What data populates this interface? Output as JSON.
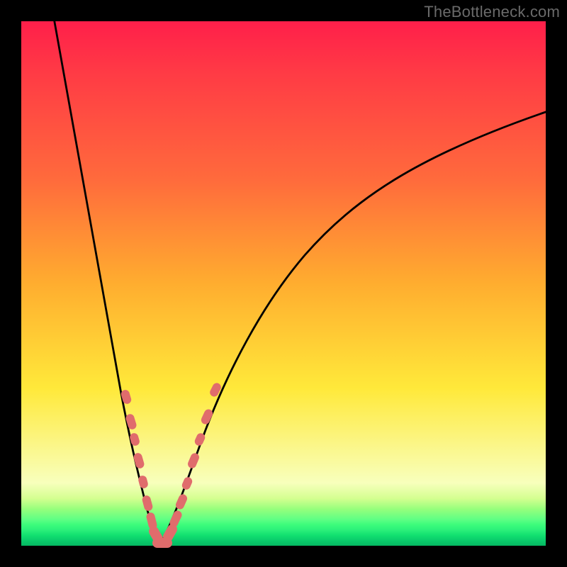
{
  "watermark": "TheBottleneck.com",
  "colors": {
    "frame": "#000000",
    "curve": "#000000",
    "salmon": "#e06c6c",
    "gradient_top": "#ff1f4a",
    "gradient_bottom": "#05b862"
  },
  "chart_data": {
    "type": "line",
    "title": "",
    "xlabel": "",
    "ylabel": "",
    "xlim": [
      0,
      100
    ],
    "ylim": [
      0,
      100
    ],
    "note": "Two monotone curves forming a V. Left branch descends steeply from top-left to a minimum near x≈25. Right branch rises from the same minimum toward upper-right, leveling off. Salmon pill-shaped markers cluster along both branches in the lower ~30% of the plot. Values estimated from pixel geometry; no axes or ticks shown.",
    "series": [
      {
        "name": "left_branch",
        "x": [
          5,
          8,
          10,
          12,
          14,
          16,
          18,
          19,
          20,
          21,
          22,
          23,
          24,
          25
        ],
        "y": [
          100,
          92,
          85,
          76,
          66,
          55,
          42,
          35,
          28,
          22,
          15,
          9,
          4,
          0
        ]
      },
      {
        "name": "right_branch",
        "x": [
          25,
          26,
          27,
          28,
          29,
          30,
          32,
          35,
          40,
          45,
          50,
          60,
          70,
          80,
          90,
          100
        ],
        "y": [
          0,
          3,
          7,
          12,
          17,
          22,
          30,
          38,
          48,
          55,
          60,
          68,
          74,
          78,
          81,
          83
        ]
      }
    ],
    "markers": [
      {
        "branch": "left",
        "x": 17.5,
        "y": 30
      },
      {
        "branch": "left",
        "x": 18.6,
        "y": 25
      },
      {
        "branch": "left",
        "x": 19.3,
        "y": 22
      },
      {
        "branch": "left",
        "x": 20.0,
        "y": 18
      },
      {
        "branch": "left",
        "x": 20.8,
        "y": 15
      },
      {
        "branch": "left",
        "x": 21.5,
        "y": 12
      },
      {
        "branch": "left",
        "x": 22.3,
        "y": 8
      },
      {
        "branch": "left",
        "x": 23.0,
        "y": 5
      },
      {
        "branch": "left",
        "x": 24.0,
        "y": 2
      },
      {
        "branch": "left",
        "x": 25.0,
        "y": 0.5
      },
      {
        "branch": "right",
        "x": 26.0,
        "y": 1
      },
      {
        "branch": "right",
        "x": 27.0,
        "y": 3
      },
      {
        "branch": "right",
        "x": 27.8,
        "y": 5
      },
      {
        "branch": "right",
        "x": 28.5,
        "y": 9
      },
      {
        "branch": "right",
        "x": 29.3,
        "y": 13
      },
      {
        "branch": "right",
        "x": 30.2,
        "y": 17
      },
      {
        "branch": "right",
        "x": 31.2,
        "y": 21
      },
      {
        "branch": "right",
        "x": 32.5,
        "y": 25
      },
      {
        "branch": "right",
        "x": 34.0,
        "y": 30
      }
    ]
  }
}
